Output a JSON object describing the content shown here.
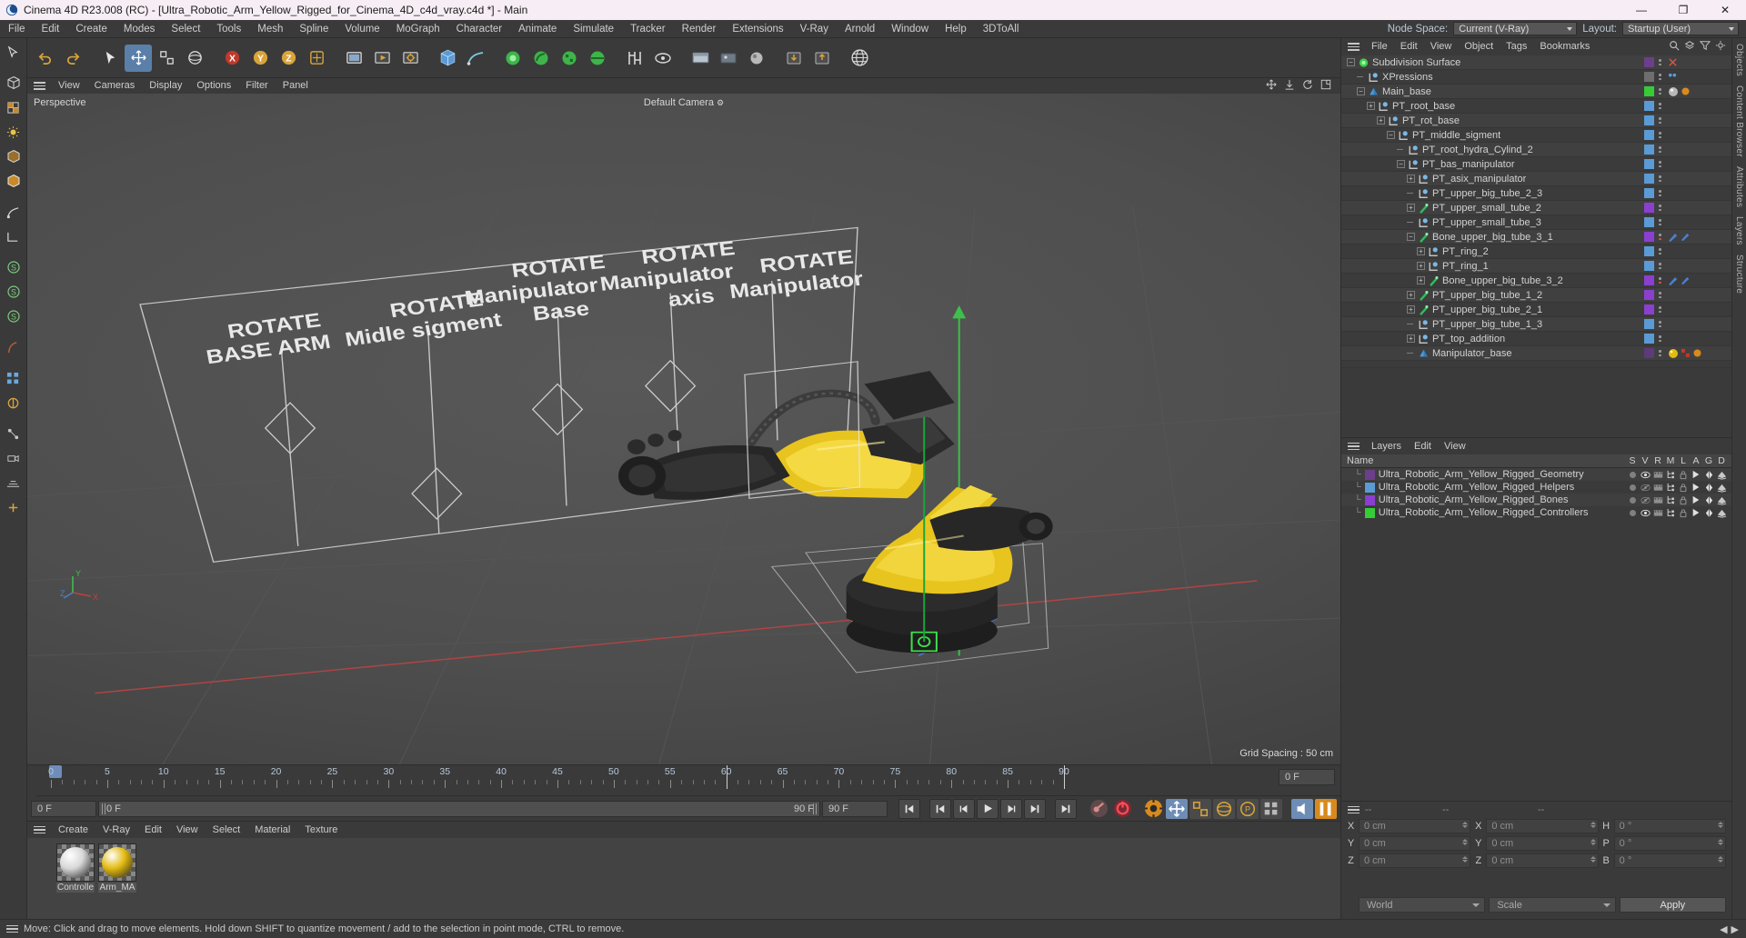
{
  "window": {
    "title": "Cinema 4D R23.008 (RC) - [Ultra_Robotic_Arm_Yellow_Rigged_for_Cinema_4D_c4d_vray.c4d *] - Main",
    "minimize": "—",
    "maximize": "❐",
    "close": "✕"
  },
  "menu": {
    "items": [
      "File",
      "Edit",
      "Create",
      "Modes",
      "Select",
      "Tools",
      "Mesh",
      "Spline",
      "Volume",
      "MoGraph",
      "Character",
      "Animate",
      "Simulate",
      "Tracker",
      "Render",
      "Extensions",
      "V-Ray",
      "Arnold",
      "Window",
      "Help",
      "3DToAll"
    ],
    "node_space_label": "Node Space:",
    "node_space_value": "Current (V-Ray)",
    "layout_label": "Layout:",
    "layout_value": "Startup (User)"
  },
  "viewport": {
    "menu": [
      "View",
      "Cameras",
      "Display",
      "Options",
      "Filter",
      "Panel"
    ],
    "label": "Perspective",
    "camera": "Default Camera",
    "grid_spacing": "Grid Spacing : 50 cm",
    "annotations": [
      {
        "line1": "ROTATE",
        "line2": "BASE ARM"
      },
      {
        "line1": "ROTATE",
        "line2": "Midle sigment"
      },
      {
        "line1": "ROTATE",
        "line2": "Manipulator",
        "line3": "Base"
      },
      {
        "line1": "ROTATE",
        "line2": "Manipulator",
        "line3": "axis"
      },
      {
        "line1": "ROTATE",
        "line2": "Manipulator"
      }
    ]
  },
  "timeline": {
    "ticks": [
      "0",
      "5",
      "10",
      "15",
      "20",
      "25",
      "30",
      "35",
      "40",
      "45",
      "50",
      "55",
      "60",
      "65",
      "70",
      "75",
      "80",
      "85",
      "90"
    ],
    "current_frame": "0 F",
    "current_frame_2": "0 F",
    "end_field": "90 F",
    "end_field_2": "90 F",
    "right_field": "0 F"
  },
  "materials": {
    "menu": [
      "Create",
      "V-Ray",
      "Edit",
      "View",
      "Select",
      "Material",
      "Texture"
    ],
    "items": [
      {
        "name": "Controlle",
        "color": "#d8d8d8"
      },
      {
        "name": "Arm_MA",
        "color": "#e3bb12"
      }
    ]
  },
  "objects": {
    "menu": [
      "File",
      "Edit",
      "View",
      "Object",
      "Tags",
      "Bookmarks"
    ],
    "rows": [
      {
        "name": "Subdivision Surface",
        "depth": 0,
        "icon": "subdivision",
        "exp": "minus",
        "swatch": "#6b3f8a",
        "tagclose": true
      },
      {
        "name": "XPressions",
        "depth": 1,
        "icon": "null",
        "exp": "none",
        "swatch": "#6e6e6e",
        "tagx": true
      },
      {
        "name": "Main_base",
        "depth": 1,
        "icon": "cone",
        "exp": "minus",
        "swatch": "#36cc36",
        "tagball": true
      },
      {
        "name": "PT_root_base",
        "depth": 2,
        "icon": "null",
        "exp": "plus",
        "swatch": "#5b9bd5"
      },
      {
        "name": "PT_rot_base",
        "depth": 3,
        "icon": "null",
        "exp": "plus",
        "swatch": "#5b9bd5"
      },
      {
        "name": "PT_middle_sigment",
        "depth": 4,
        "icon": "null",
        "exp": "minus",
        "swatch": "#5b9bd5"
      },
      {
        "name": "PT_root_hydra_Cylind_2",
        "depth": 5,
        "icon": "null",
        "exp": "none",
        "swatch": "#5b9bd5"
      },
      {
        "name": "PT_bas_manipulator",
        "depth": 5,
        "icon": "null",
        "exp": "minus",
        "swatch": "#5b9bd5"
      },
      {
        "name": "PT_asix_manipulator",
        "depth": 6,
        "icon": "null",
        "exp": "plus",
        "swatch": "#5b9bd5"
      },
      {
        "name": "PT_upper_big_tube_2_3",
        "depth": 6,
        "icon": "null",
        "exp": "none",
        "swatch": "#5b9bd5"
      },
      {
        "name": "PT_upper_small_tube_2",
        "depth": 6,
        "icon": "bone",
        "exp": "plus",
        "swatch": "#8b3fcf"
      },
      {
        "name": "PT_upper_small_tube_3",
        "depth": 6,
        "icon": "null",
        "exp": "none",
        "swatch": "#5b9bd5"
      },
      {
        "name": "Bone_upper_big_tube_3_1",
        "depth": 6,
        "icon": "bone",
        "exp": "minus",
        "swatch": "#8b3fcf",
        "tagbone": true
      },
      {
        "name": "PT_ring_2",
        "depth": 7,
        "icon": "null",
        "exp": "plus",
        "swatch": "#5b9bd5"
      },
      {
        "name": "PT_ring_1",
        "depth": 7,
        "icon": "null",
        "exp": "plus",
        "swatch": "#5b9bd5"
      },
      {
        "name": "Bone_upper_big_tube_3_2",
        "depth": 7,
        "icon": "bone",
        "exp": "plus",
        "swatch": "#8b3fcf",
        "tagbone": true
      },
      {
        "name": "PT_upper_big_tube_1_2",
        "depth": 6,
        "icon": "bone",
        "exp": "plus",
        "swatch": "#8b3fcf"
      },
      {
        "name": "PT_upper_big_tube_2_1",
        "depth": 6,
        "icon": "bone",
        "exp": "plus",
        "swatch": "#8b3fcf"
      },
      {
        "name": "PT_upper_big_tube_1_3",
        "depth": 6,
        "icon": "null",
        "exp": "none",
        "swatch": "#5b9bd5"
      },
      {
        "name": "PT_top_addition",
        "depth": 6,
        "icon": "null",
        "exp": "plus",
        "swatch": "#5b9bd5"
      },
      {
        "name": "Manipulator_base",
        "depth": 6,
        "icon": "cone",
        "exp": "none",
        "swatch": "#5e3a78",
        "tagyellow": true
      }
    ]
  },
  "layers": {
    "menu": [
      "Layers",
      "Edit",
      "View"
    ],
    "columns": [
      "Name",
      "S",
      "V",
      "R",
      "M",
      "L",
      "A",
      "G",
      "D"
    ],
    "rows": [
      {
        "name": "Ultra_Robotic_Arm_Yellow_Rigged_Geometry",
        "color": "#6b3f8a",
        "visible": true
      },
      {
        "name": "Ultra_Robotic_Arm_Yellow_Rigged_Helpers",
        "color": "#5b9bd5",
        "visible": false
      },
      {
        "name": "Ultra_Robotic_Arm_Yellow_Rigged_Bones",
        "color": "#8b3fcf",
        "visible": false
      },
      {
        "name": "Ultra_Robotic_Arm_Yellow_Rigged_Controllers",
        "color": "#36cc36",
        "visible": true
      }
    ]
  },
  "coords": {
    "placeholder_dash": "--",
    "rows": [
      {
        "label1": "X",
        "val1": "0 cm",
        "label2": "X",
        "val2": "0 cm",
        "label3": "H",
        "val3": "0 °"
      },
      {
        "label1": "Y",
        "val1": "0 cm",
        "label2": "Y",
        "val2": "0 cm",
        "label3": "P",
        "val3": "0 °"
      },
      {
        "label1": "Z",
        "val1": "0 cm",
        "label2": "Z",
        "val2": "0 cm",
        "label3": "B",
        "val3": "0 °"
      }
    ],
    "world": "World",
    "scale": "Scale",
    "apply": "Apply"
  },
  "sidebar_right_tabs": [
    "Objects",
    "Content Browser",
    "Attributes",
    "Layers",
    "Structure"
  ],
  "status": {
    "message": "Move: Click and drag to move elements. Hold down SHIFT to quantize movement / add to the selection in point mode, CTRL to remove."
  }
}
